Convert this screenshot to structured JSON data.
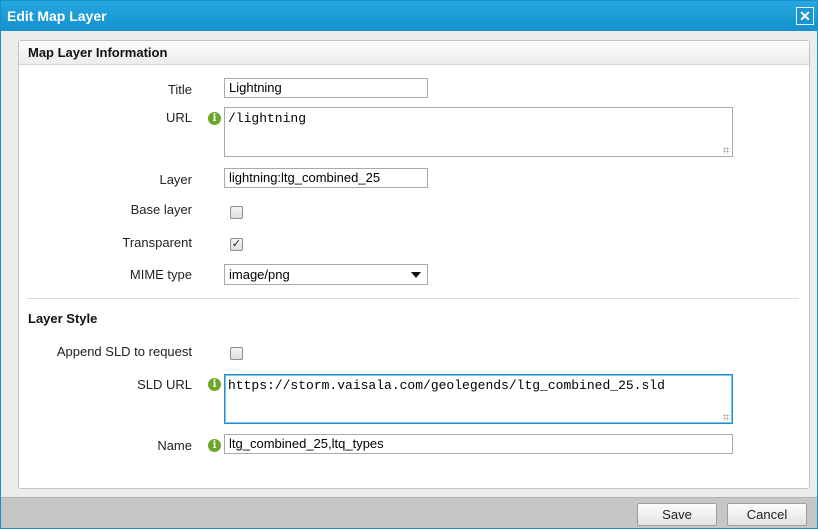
{
  "window": {
    "title": "Edit Map Layer",
    "close_glyph": "✕"
  },
  "info_section": {
    "heading": "Map Layer Information",
    "title_label": "Title",
    "title_value": "Lightning",
    "url_label": "URL",
    "url_value": "/lightning",
    "layer_label": "Layer",
    "layer_value": "lightning:ltg_combined_25",
    "base_layer_label": "Base layer",
    "base_layer_checked": false,
    "transparent_label": "Transparent",
    "transparent_checked": true,
    "transparent_glyph": "✓",
    "mime_label": "MIME type",
    "mime_value": "image/png"
  },
  "style_section": {
    "heading": "Layer Style",
    "append_sld_label": "Append SLD to request",
    "append_sld_checked": false,
    "sld_url_label": "SLD URL",
    "sld_url_value": "https://storm.vaisala.com/geolegends/ltg_combined_25.sld",
    "name_label": "Name",
    "name_value": "ltg_combined_25,ltq_types"
  },
  "icons": {
    "info": "info-icon",
    "info_glyph": "i"
  },
  "footer": {
    "save_label": "Save",
    "cancel_label": "Cancel"
  },
  "colors": {
    "titlebar": "#1a9ad6",
    "info_icon": "#6ba82a",
    "focus_border": "#1f8fd0"
  }
}
